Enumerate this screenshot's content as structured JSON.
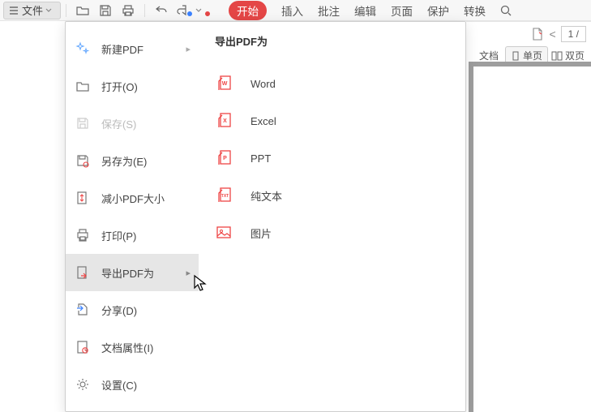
{
  "toolbar": {
    "file_label": "文件",
    "tabs": {
      "start": "开始",
      "insert": "插入",
      "annotate": "批注",
      "edit": "编辑",
      "page": "页面",
      "protect": "保护",
      "convert": "转换"
    }
  },
  "right": {
    "arrow_left": "<",
    "page_curr": "1 /",
    "doc_label": "文档",
    "single": "单页",
    "double": "双页"
  },
  "menu": {
    "new_pdf": "新建PDF",
    "open": "打开(O)",
    "save": "保存(S)",
    "save_as": "另存为(E)",
    "shrink": "减小PDF大小",
    "print": "打印(P)",
    "export": "导出PDF为",
    "share": "分享(D)",
    "props": "文档属性(I)",
    "settings": "设置(C)"
  },
  "submenu": {
    "title": "导出PDF为",
    "word": "Word",
    "excel": "Excel",
    "ppt": "PPT",
    "txt": "纯文本",
    "image": "图片"
  }
}
